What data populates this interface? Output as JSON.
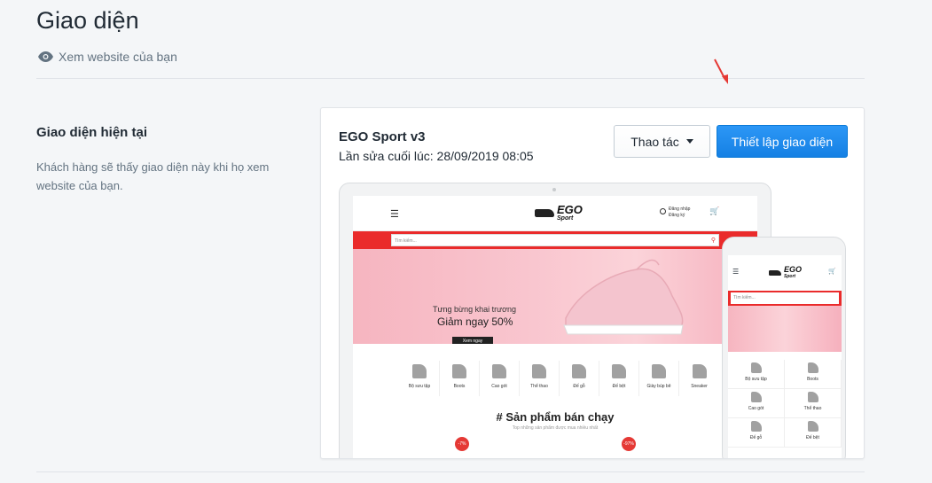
{
  "header": {
    "title": "Giao diện",
    "view_link": "Xem website của bạn"
  },
  "section": {
    "title": "Giao diện hiện tại",
    "description": "Khách hàng sẽ thấy giao diện này khi họ xem website của bạn."
  },
  "theme": {
    "name": "EGO Sport v3",
    "updated": "Lần sửa cuối lúc: 28/09/2019 08:05",
    "actions_label": "Thao tác",
    "setup_label": "Thiết lập giao diện"
  },
  "preview": {
    "logo": "EGO",
    "logo_sub": "Sport",
    "login": "Đăng nhập",
    "register": "Đăng ký",
    "cart_count": "0",
    "search_placeholder": "Tìm kiếm...",
    "hero_line1": "Tưng bừng khai trương",
    "hero_line2": "Giảm ngay 50%",
    "hero_button": "Xem ngay",
    "categories": [
      "Bộ sưu tập",
      "Boots",
      "Cao gót",
      "Thể thao",
      "Đế gỗ",
      "Đế bệt",
      "Giày búp bê",
      "Sneaker"
    ],
    "best_title": "# Sản phẩm bán chạy",
    "best_sub": "Top những sản phẩm được mua nhiều nhất",
    "discount1": "-7%",
    "discount2": "-97%",
    "mobile_categories": [
      "Bộ sưu tập",
      "Boots",
      "Cao gót",
      "Thể thao",
      "Đế gỗ",
      "Đế bệt"
    ]
  },
  "colors": {
    "primary": "#1580e4",
    "annotation_arrow": "#e53935",
    "preview_bar": "#ea2b2b"
  }
}
